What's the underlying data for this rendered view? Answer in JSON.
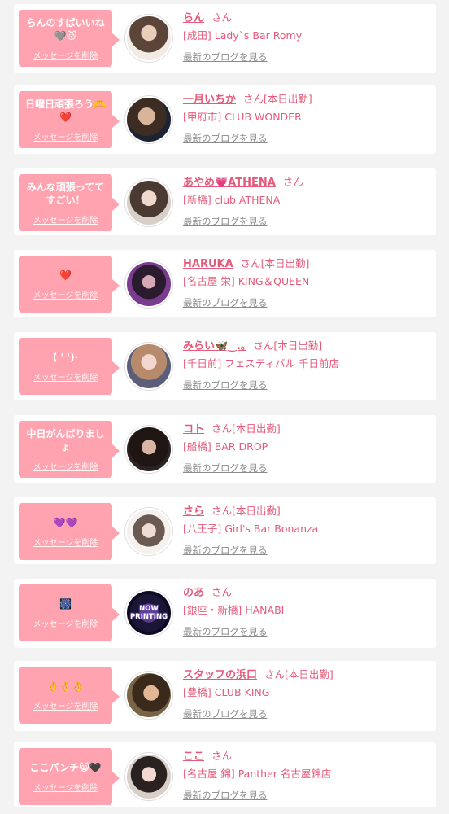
{
  "colors": {
    "accent": "#e55a7a",
    "bubble": "#ffa3b0",
    "background": "#f3f3f3"
  },
  "delete_label": "メッセージを削除",
  "blog_label": "最新のブログを見る",
  "san_label": "さん",
  "entries": [
    {
      "message": "らんのすばいいね🩶🐱",
      "name": "らん",
      "status": "",
      "shop": "[成田] Lady`s Bar Romy"
    },
    {
      "message": "日曜日頑張ろう🫶❤️",
      "name": "一月いちか",
      "status": "[本日出勤]",
      "shop": "[甲府市] CLUB WONDER"
    },
    {
      "message": "みんな頑張っててすごい！",
      "name": "あやめ💗ATHENA",
      "status": "",
      "shop": "[新橋] club ATHENA"
    },
    {
      "message": "❤️",
      "name": "HARUKA",
      "status": "[本日出勤]",
      "shop": "[名古屋 栄] KING＆QUEEN"
    },
    {
      "message": "( ' ')·",
      "name": "みらい🦋‿.｡",
      "status": "[本日出勤]",
      "shop": "[千日前] フェスティバル 千日前店"
    },
    {
      "message": "中日がんばりましょ",
      "name": "コト",
      "status": "[本日出勤]",
      "shop": "[船橋] BAR DROP"
    },
    {
      "message": "💜💜",
      "name": "さら",
      "status": "[本日出勤]",
      "shop": "[八王子] Girl's Bar Bonanza"
    },
    {
      "message": "🎆",
      "name": "のあ",
      "status": "",
      "shop": "[銀座・新橋] HANABI",
      "avatar_text": "NOW PRINTING"
    },
    {
      "message": "👌👌👌",
      "name": "スタッフの浜口",
      "status": "[本日出勤]",
      "shop": "[豊橋] CLUB KING"
    },
    {
      "message": "ここパンチ😸🖤",
      "name": "ここ",
      "status": "",
      "shop": "[名古屋 錦] Panther 名古屋錦店"
    }
  ]
}
